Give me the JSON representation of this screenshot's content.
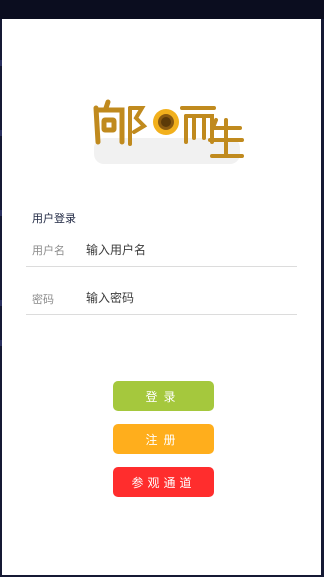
{
  "logo": {
    "text": "向阳而生"
  },
  "login": {
    "title": "用户登录",
    "username": {
      "label": "用户名",
      "placeholder": "输入用户名",
      "value": ""
    },
    "password": {
      "label": "密码",
      "placeholder": "输入密码",
      "value": ""
    }
  },
  "buttons": {
    "login": "登录",
    "register": "注册",
    "guest": "参观通道"
  },
  "colors": {
    "login": "#a5c83d",
    "register": "#ffae1c",
    "guest": "#ff2d2d",
    "logo": "#c08a1e",
    "sunflower": "#f2b01c"
  }
}
